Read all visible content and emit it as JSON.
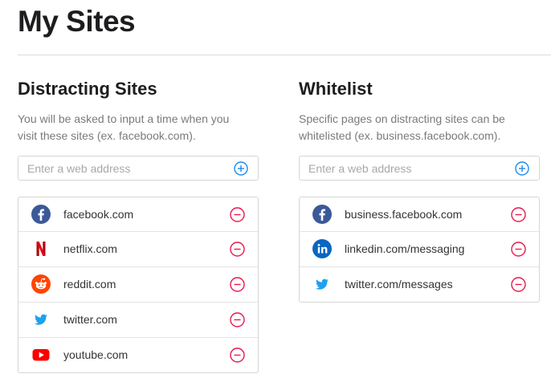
{
  "page": {
    "title": "My Sites"
  },
  "distracting": {
    "title": "Distracting Sites",
    "description": "You will be asked to input a time when you visit these sites (ex. facebook.com).",
    "input_placeholder": "Enter a web address",
    "items": [
      {
        "label": "facebook.com",
        "icon": "facebook-icon"
      },
      {
        "label": "netflix.com",
        "icon": "netflix-icon"
      },
      {
        "label": "reddit.com",
        "icon": "reddit-icon"
      },
      {
        "label": "twitter.com",
        "icon": "twitter-icon"
      },
      {
        "label": "youtube.com",
        "icon": "youtube-icon"
      }
    ]
  },
  "whitelist": {
    "title": "Whitelist",
    "description": "Specific pages on distracting sites can be whitelisted (ex. business.facebook.com).",
    "input_placeholder": "Enter a web address",
    "items": [
      {
        "label": "business.facebook.com",
        "icon": "facebook-icon"
      },
      {
        "label": "linkedin.com/messaging",
        "icon": "linkedin-icon"
      },
      {
        "label": "twitter.com/messages",
        "icon": "twitter-icon"
      }
    ]
  },
  "colors": {
    "add": "#1a8cf0",
    "remove": "#e8194f",
    "facebook": "#3b5998",
    "netflix": "#e50914",
    "reddit": "#ff4500",
    "twitter": "#1da1f2",
    "youtube": "#ff0000",
    "linkedin": "#0a66c2"
  }
}
